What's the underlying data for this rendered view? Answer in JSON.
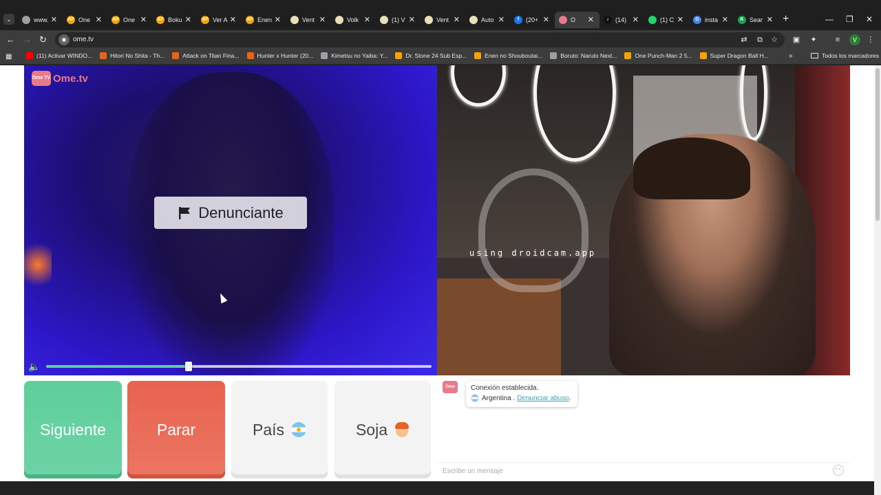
{
  "tabs": [
    {
      "label": "www.",
      "color": "#9aa0a6",
      "glyph": ""
    },
    {
      "label": "One",
      "color": "#f4a300",
      "glyph": "AF"
    },
    {
      "label": "One",
      "color": "#f4a300",
      "glyph": "AF"
    },
    {
      "label": "Boku",
      "color": "#f4a300",
      "glyph": "AF"
    },
    {
      "label": "Ver A",
      "color": "#f4a300",
      "glyph": "AF"
    },
    {
      "label": "Enen",
      "color": "#f4a300",
      "glyph": "AF"
    },
    {
      "label": "Vent",
      "color": "#e8e0b8",
      "glyph": ""
    },
    {
      "label": "Volk",
      "color": "#e8e0b8",
      "glyph": ""
    },
    {
      "label": "(1) V",
      "color": "#e8e0b8",
      "glyph": ""
    },
    {
      "label": "Vent",
      "color": "#e8e0b8",
      "glyph": ""
    },
    {
      "label": "Auto",
      "color": "#e8e0b8",
      "glyph": ""
    },
    {
      "label": "(20+",
      "color": "#1877f2",
      "glyph": "f"
    },
    {
      "label": "O",
      "color": "#e87a8a",
      "glyph": "",
      "active": true
    },
    {
      "label": "(14)",
      "color": "#111111",
      "glyph": "♪"
    },
    {
      "label": "(1) C",
      "color": "#25d366",
      "glyph": ""
    },
    {
      "label": "insta",
      "color": "#4285f4",
      "glyph": "G"
    },
    {
      "label": "Sear",
      "color": "#1aa34a",
      "glyph": "K"
    }
  ],
  "toolbar": {
    "url": "ome.tv",
    "profile_initial": "V"
  },
  "bookmarks": [
    {
      "label": "(11) Activar WINDO...",
      "color": "#ff0000"
    },
    {
      "label": "Hitori No Shita - Th...",
      "color": "#e8641b"
    },
    {
      "label": "Attack on Titan Fina...",
      "color": "#e8641b"
    },
    {
      "label": "Hunter x Hunter (20...",
      "color": "#e8641b"
    },
    {
      "label": "Kimetsu no Yaiba: Y...",
      "color": "#9aa0a6"
    },
    {
      "label": "Dr. Stone 24 Sub Esp...",
      "color": "#f4a300"
    },
    {
      "label": "Enen no Shouboutai...",
      "color": "#f4a300"
    },
    {
      "label": "Boruto: Naruto Next...",
      "color": "#9aa0a6"
    },
    {
      "label": "One Punch-Man 2 5...",
      "color": "#f4a300"
    },
    {
      "label": "Super Dragon Ball H...",
      "color": "#f4a300"
    }
  ],
  "bookmarks_folder": "Todos los marcadores",
  "site": {
    "logo_badge": "Ome TV",
    "logo_text": "Ome.tv",
    "report_button": "Denunciante",
    "watermark": "using droidcam.app",
    "volume_level": 0.37
  },
  "buttons": {
    "next": "Siguiente",
    "stop": "Parar",
    "country": "País",
    "gender": "Soja"
  },
  "chat": {
    "avatar_badge": "Ome TV",
    "status": "Conexión establecida.",
    "country": "Argentina .",
    "report_link": "Denunciar abuso",
    "report_link_suffix": ".",
    "input_placeholder": "Escribe un mensaje"
  },
  "colors": {
    "next": "#5fcf9c",
    "stop": "#e7634e",
    "accent_link": "#3aa6b9",
    "brand": "#e87a8a"
  }
}
